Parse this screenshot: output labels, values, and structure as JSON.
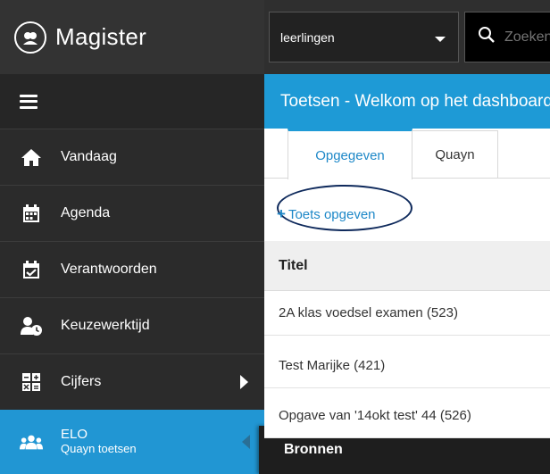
{
  "app": {
    "logo_text": "Magister"
  },
  "sidebar": {
    "items": [
      {
        "label": "Vandaag",
        "icon": "home-icon"
      },
      {
        "label": "Agenda",
        "icon": "calendar-icon"
      },
      {
        "label": "Verantwoorden",
        "icon": "calendar-check-icon"
      },
      {
        "label": "Keuzewerktijd",
        "icon": "user-clock-icon"
      },
      {
        "label": "Cijfers",
        "icon": "grades-grid-icon"
      },
      {
        "label": "ELO",
        "sublabel": "Quayn toetsen",
        "icon": "group-icon",
        "active": true
      }
    ],
    "submenu": {
      "label": "Bronnen"
    }
  },
  "topbar": {
    "scope_select": "leerlingen",
    "search_placeholder": "Zoeken"
  },
  "page": {
    "title": "Toetsen - Welkom op het dashboard",
    "tabs": [
      {
        "label": "Opgegeven",
        "active": true
      },
      {
        "label": "Quayn",
        "active": false
      }
    ],
    "add_action": "Toets opgeven",
    "table": {
      "column_title": "Titel",
      "rows": [
        "2A klas voedsel examen (523)",
        "Test Marijke (421)",
        "Opgave van '14okt test' 44 (526)"
      ]
    }
  },
  "colors": {
    "accent": "#1e9ad6",
    "link": "#1e88c8",
    "sidebar_bg": "#2b2b2b",
    "highlight_ellipse": "#0f2a5c"
  }
}
